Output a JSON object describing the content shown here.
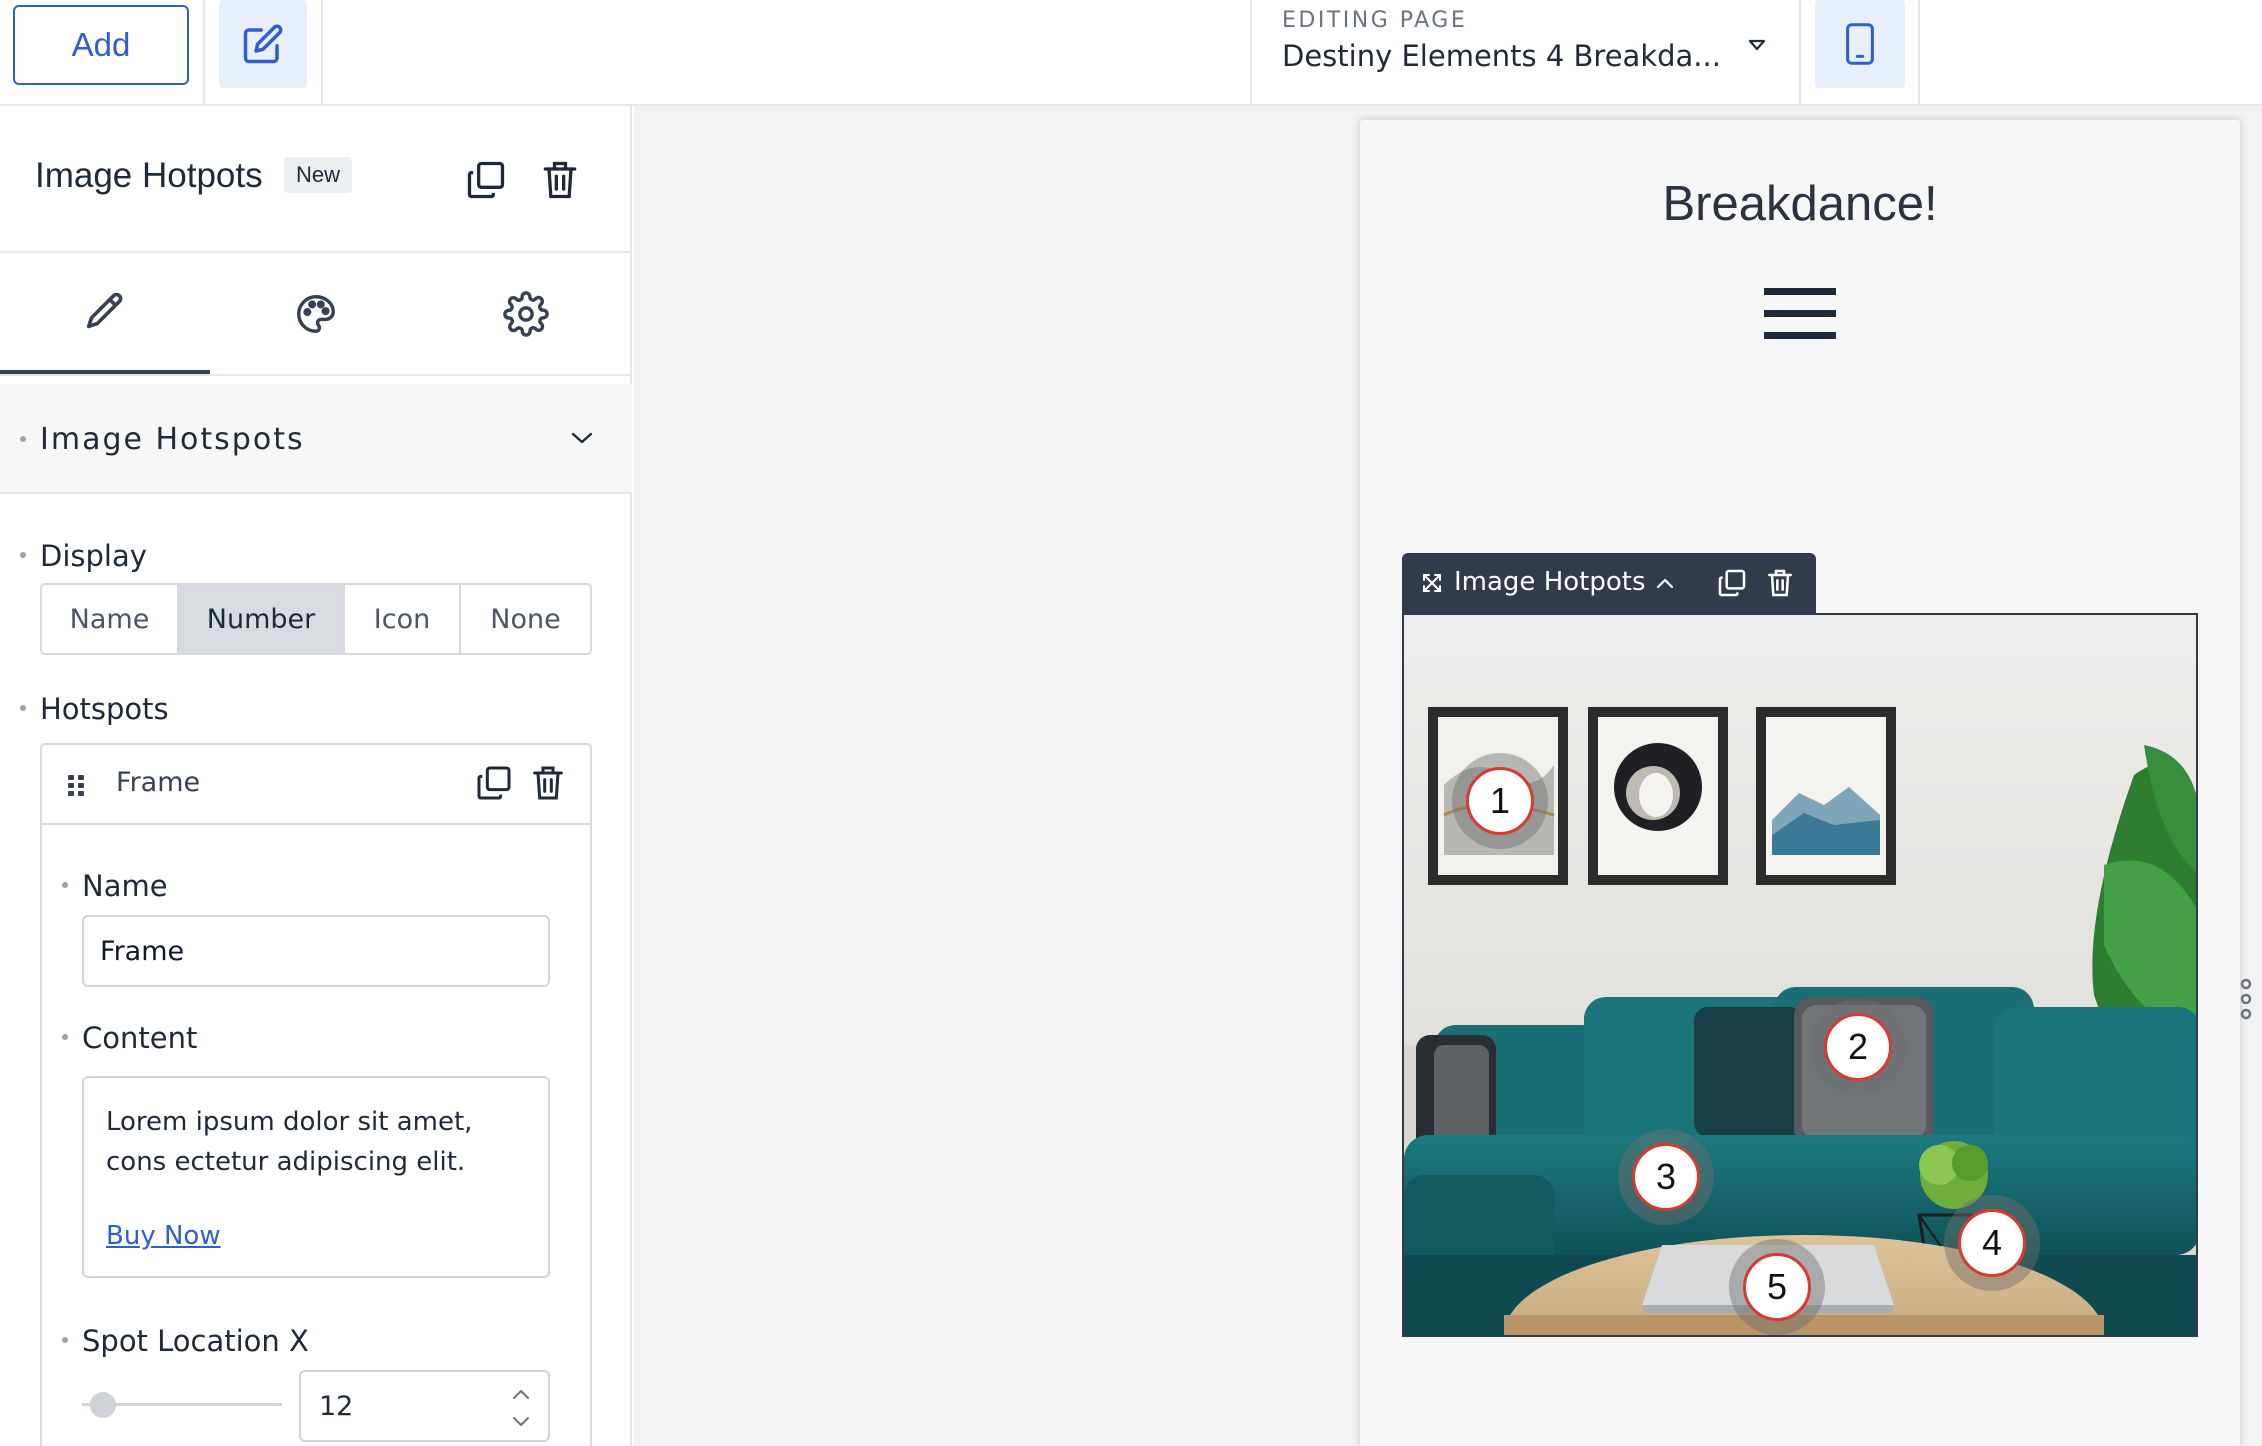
{
  "topbar": {
    "add_label": "Add",
    "editing_label": "EDITING PAGE",
    "editing_value": "Destiny Elements 4 Breakda..."
  },
  "panel": {
    "element_title": "Image Hotpots",
    "badge": "New",
    "section_title": "Image Hotspots",
    "display_label": "Display",
    "display_options": [
      "Name",
      "Number",
      "Icon",
      "None"
    ],
    "display_selected": "Number",
    "hotspots_label": "Hotspots",
    "hotspot_item": {
      "title": "Frame",
      "name_label": "Name",
      "name_value": "Frame",
      "content_label": "Content",
      "content_text": "Lorem ipsum dolor sit amet, cons ectetur adipiscing elit.",
      "content_link": "Buy Now",
      "spot_x_label": "Spot Location X",
      "spot_x_value": "12"
    }
  },
  "canvas": {
    "site_title": "Breakdance!",
    "toolbar_label": "Image Hotpots",
    "hotspots": [
      "1",
      "2",
      "3",
      "4",
      "5"
    ]
  },
  "colors": {
    "accent": "#2f5fce",
    "toolbar_bg": "#323a4c",
    "hotspot_ring": "#d83a2e",
    "sofa": "#17656b"
  }
}
